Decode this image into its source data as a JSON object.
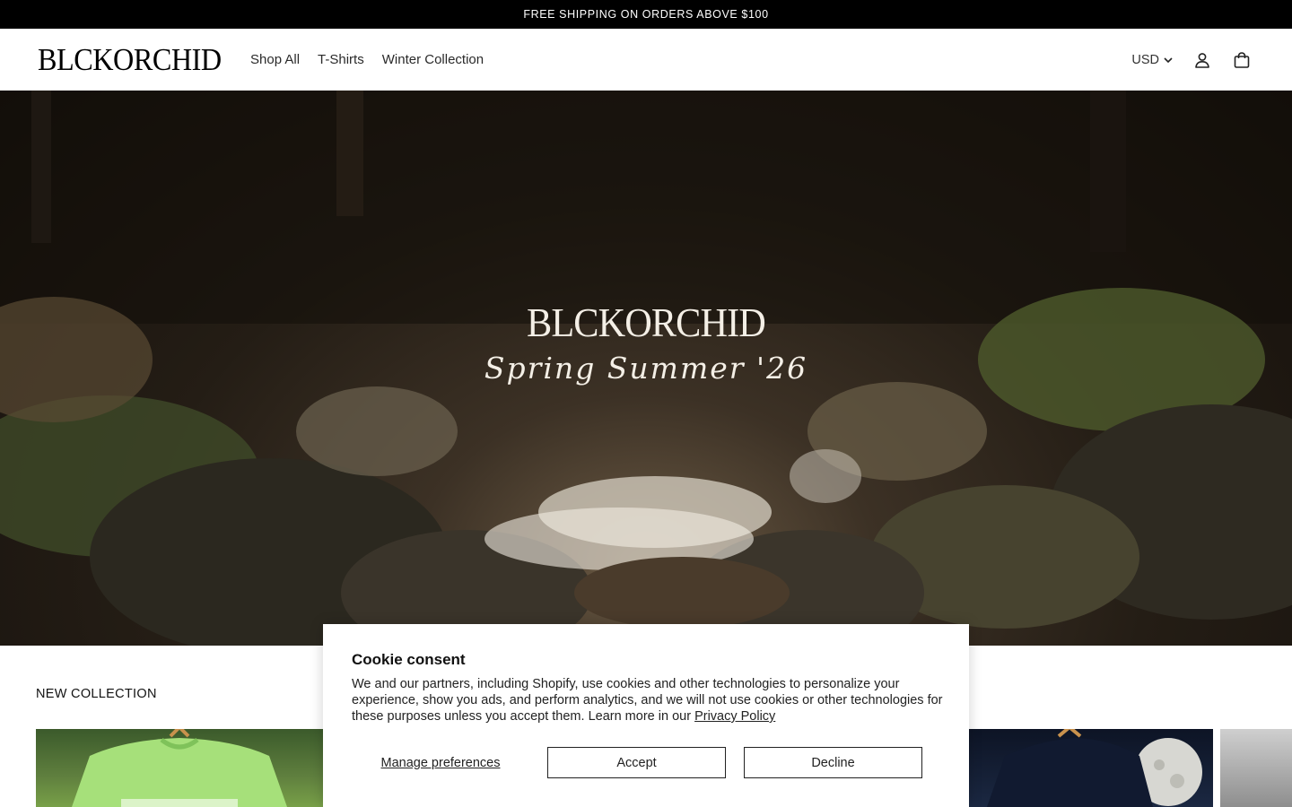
{
  "announcement": {
    "text": "FREE SHIPPING ON ORDERS ABOVE $100"
  },
  "header": {
    "logo": "BLCKORCHID",
    "nav": [
      "Shop All",
      "T-Shirts",
      "Winter Collection"
    ],
    "currency": "USD"
  },
  "hero": {
    "brand": "BLCKORCHID",
    "subtitle": "Spring Summer '26"
  },
  "collection": {
    "title": "NEW COLLECTION"
  },
  "cookie": {
    "title": "Cookie consent",
    "body": "We and our partners, including Shopify, use cookies and other technologies to personalize your experience, show you ads, and perform analytics, and we will not use cookies or other technologies for these purposes unless you accept them. Learn more in our",
    "policy_link": "Privacy Policy",
    "manage": "Manage preferences",
    "accept": "Accept",
    "decline": "Decline"
  }
}
